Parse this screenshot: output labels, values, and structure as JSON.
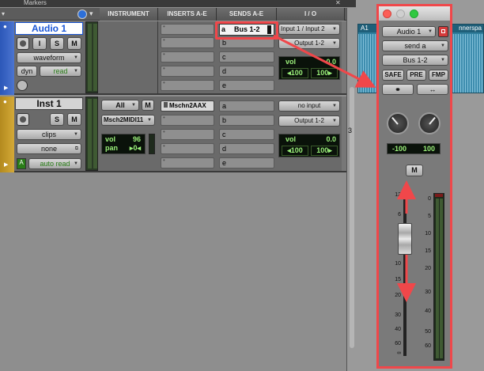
{
  "header": {
    "markers": "Markers",
    "columns": [
      "INSTRUMENT",
      "INSERTS A-E",
      "SENDS A-E",
      "I / O"
    ]
  },
  "track1": {
    "name": "Audio 1",
    "view": "waveform",
    "dyn": "dyn",
    "automation": "read",
    "btn_i": "I",
    "btn_s": "S",
    "btn_m": "M",
    "send_letters": [
      "a",
      "b",
      "c",
      "d",
      "e"
    ],
    "send_a_value": "Bus 1-2",
    "input": "Input 1 / Input 2",
    "output": "Output 1-2",
    "vol_label": "vol",
    "vol_value": "0.0",
    "pan_left": "◂100",
    "pan_right": "100▸"
  },
  "track2": {
    "name": "Inst 1",
    "view": "clips",
    "group": "none",
    "automation": "auto read",
    "btn_s": "S",
    "btn_m": "M",
    "instrument_select": "All",
    "instrument_m": "M",
    "instrument_plugin": "Msch2MIDI11",
    "inst_vol_label": "vol",
    "inst_vol_value": "96",
    "inst_pan_label": "pan",
    "inst_pan_value": "0",
    "insert_a": "Mschn2AAX",
    "send_letters": [
      "a",
      "b",
      "c",
      "d",
      "e"
    ],
    "input": "no input",
    "output": "Output 1-2",
    "vol_label": "vol",
    "vol_value": "0.0",
    "pan_left": "◂100",
    "pan_right": "100▸"
  },
  "clips": {
    "audio_clip_name": "A1",
    "audio_clip_tail": "nnerspa",
    "ruler_number": "3"
  },
  "send_window": {
    "track": "Audio 1",
    "send": "send a",
    "bus": "Bus 1-2",
    "safe": "SAFE",
    "pre": "PRE",
    "fmp": "FMP",
    "pan_left": "-100",
    "pan_right": "100",
    "mute": "M",
    "fader_scale": [
      "12",
      "6",
      "0",
      "5",
      "10",
      "15",
      "20",
      "30",
      "40",
      "60",
      "∞"
    ],
    "meter_scale": [
      "0",
      "5",
      "10",
      "15",
      "20",
      "30",
      "40",
      "50",
      "60"
    ]
  },
  "colors": {
    "highlight": "#f0474a",
    "track1_name": "#1a56d6",
    "lcd_text": "#9bf07a",
    "send_window_bg": "#7a7a7a"
  }
}
